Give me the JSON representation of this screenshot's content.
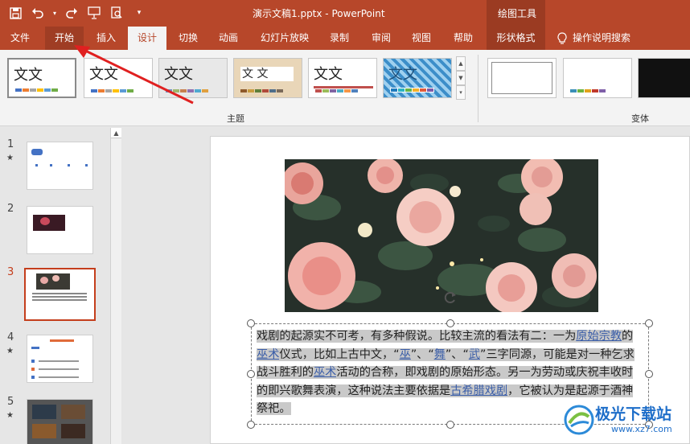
{
  "title_bar": {
    "document_title": "演示文稿1.pptx  -  PowerPoint",
    "context_group": "绘图工具",
    "qat_icons": [
      "save-icon",
      "undo-icon",
      "redo-icon",
      "present-icon",
      "print-preview-icon",
      "customize-icon"
    ]
  },
  "tabs": [
    {
      "label": "文件"
    },
    {
      "label": "开始"
    },
    {
      "label": "插入"
    },
    {
      "label": "设计"
    },
    {
      "label": "切换"
    },
    {
      "label": "动画"
    },
    {
      "label": "幻灯片放映"
    },
    {
      "label": "录制"
    },
    {
      "label": "审阅"
    },
    {
      "label": "视图"
    },
    {
      "label": "帮助"
    },
    {
      "label": "形状格式"
    }
  ],
  "search": {
    "label": "操作说明搜索",
    "icon": "lightbulb-icon"
  },
  "ribbon": {
    "themes_group_label": "主题",
    "variants_group_label": "变体",
    "theme_sample_text": "文文",
    "theme_sample_text_alt": "文 文"
  },
  "slides": [
    {
      "number": "1",
      "starred": "★"
    },
    {
      "number": "2",
      "starred": ""
    },
    {
      "number": "3",
      "starred": ""
    },
    {
      "number": "4",
      "starred": "★"
    },
    {
      "number": "5",
      "starred": "★"
    }
  ],
  "slide_text": {
    "p1": "戏剧的起源实不可考，有多种假说。比较主流的看法有二：一为",
    "link1": "原始宗教",
    "p2": "的",
    "link2": "巫术",
    "p3": "仪式，比如上古中文，“",
    "link3": "巫",
    "p4": "”、“",
    "link4": "舞",
    "p5": "”、“",
    "link5": "武",
    "p6": "”三字同源，可能是对一种乞求战斗胜利的",
    "link6": "巫术",
    "p7": "活动的合称，即戏剧的原始形态。另一为劳动或庆祝丰收时的即兴歌舞表演，这种说法主要依据是",
    "link7": "古希腊戏剧",
    "p8": "，它被认为是起源于酒神祭祀。"
  },
  "watermark": {
    "text": "极光下载站",
    "url": "www.xz7.com"
  },
  "colors": {
    "accent": "#b7472a",
    "selection": "#c43e1c",
    "highlight": "#c9c9c9"
  }
}
